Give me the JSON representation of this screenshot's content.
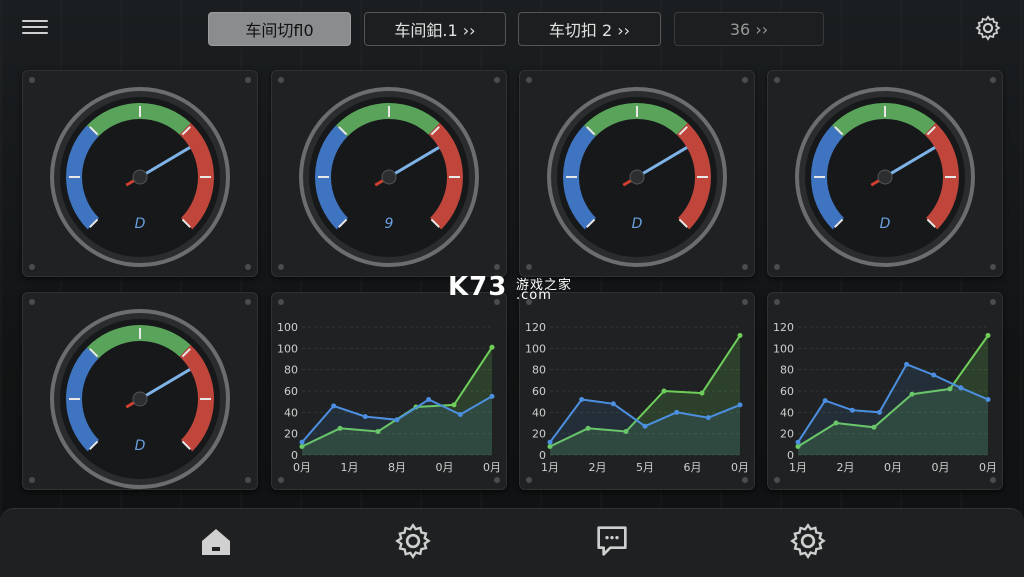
{
  "tabs": [
    {
      "label": "车间切fl0",
      "active": true
    },
    {
      "label": "车间鈤.1 ››",
      "active": false
    },
    {
      "label": "车切扣 2 ››",
      "active": false
    },
    {
      "label": "36 ››",
      "active": false
    }
  ],
  "icons": {
    "menu": "menu-icon",
    "settings": "gear-icon",
    "home": "home-icon",
    "chat": "chat-icon"
  },
  "gauges": [
    {
      "value_label": "D",
      "level": 0.72
    },
    {
      "value_label": "9",
      "level": 0.72
    },
    {
      "value_label": "D",
      "level": 0.72
    },
    {
      "value_label": "D",
      "level": 0.72
    },
    {
      "value_label": "D",
      "level": 0.72
    }
  ],
  "watermark": {
    "brand": "K73",
    "sub": "游戏之家",
    "domain": ".com"
  },
  "colors": {
    "blue": "#3f74c0",
    "green": "#5aa35a",
    "red": "#c0463c",
    "line_blue": "#4c8fe0",
    "line_green": "#6fcf5a"
  },
  "chart_data": [
    {
      "type": "line",
      "y_ticks": [
        "100",
        "100",
        "80",
        "60",
        "40",
        "20",
        "0"
      ],
      "x_ticks": [
        "0月",
        "1月",
        "8月",
        "0月",
        "0月"
      ],
      "ylim": [
        0,
        120
      ],
      "series": [
        {
          "values": [
            8,
            25,
            22,
            45,
            47,
            101
          ]
        },
        {
          "values": [
            12,
            46,
            36,
            33,
            52,
            38,
            55
          ]
        }
      ]
    },
    {
      "type": "line",
      "y_ticks": [
        "120",
        "100",
        "80",
        "60",
        "40",
        "20",
        "0"
      ],
      "x_ticks": [
        "1月",
        "2月",
        "5月",
        "6月",
        "0月"
      ],
      "ylim": [
        0,
        120
      ],
      "series": [
        {
          "values": [
            8,
            25,
            22,
            60,
            58,
            112
          ]
        },
        {
          "values": [
            12,
            52,
            48,
            27,
            40,
            35,
            47
          ]
        }
      ]
    },
    {
      "type": "line",
      "y_ticks": [
        "120",
        "100",
        "80",
        "60",
        "40",
        "20",
        "0"
      ],
      "x_ticks": [
        "1月",
        "2月",
        "0月",
        "0月",
        "0月"
      ],
      "ylim": [
        0,
        120
      ],
      "series": [
        {
          "values": [
            8,
            30,
            26,
            57,
            62,
            112
          ]
        },
        {
          "values": [
            12,
            51,
            42,
            40,
            85,
            75,
            63,
            52
          ]
        }
      ]
    }
  ]
}
